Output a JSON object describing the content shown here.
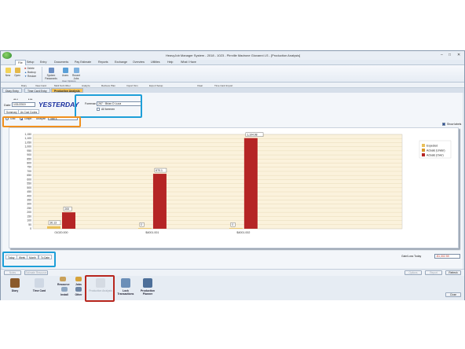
{
  "window": {
    "title": "HeavyJob Manager System - 2018 - 1023 - Plrrville Madrone Giovanni LS - [Production Analysis]",
    "controls": {
      "min": "–",
      "max": "□",
      "close": "✕"
    }
  },
  "menu": [
    "File",
    "Setup",
    "Entry",
    "Documents",
    "Pay Estimate",
    "Reports",
    "Exchange",
    "Overview",
    "Utilities",
    "Help",
    "What I Have"
  ],
  "ribbon": {
    "buttons": [
      "New",
      "Open",
      "Delete",
      "Backup",
      "Restore",
      "System Passwords",
      "Users",
      "Recent Jobs"
    ],
    "group_label": "User Options"
  },
  "toolbar": [
    "Diary",
    "View Card",
    "Multi Sub Other",
    "Analyze",
    "Retrieve Plan",
    "Import Sim",
    "Export Setup",
    "Clear",
    "Time Card Import"
  ],
  "tabs": [
    "Diary Entry",
    "Time Card Entry",
    "Production Analysis"
  ],
  "header": {
    "date_label": "Date",
    "date_value": "1/31/2019",
    "yesterday": "YESTERDAY",
    "foreman_label": "Foreman",
    "foreman_value": "267 · Brian D Luca",
    "all_foremen": "All foremen"
  },
  "subtabs": [
    "Summary",
    "As Cost Codes"
  ],
  "view": {
    "grid": "Grid",
    "graph": "Graph",
    "analyze_label": "Analyze",
    "analyze_value": "Total $"
  },
  "show_labels": "Show labels",
  "chart_data": {
    "type": "bar",
    "categories": [
      "01020.000",
      "$4001.001",
      "$4001.002"
    ],
    "series": [
      {
        "name": "Expected",
        "values": [
          30.13,
          0,
          0
        ],
        "color": "#e9c05a"
      },
      {
        "name": "Actuals (Under)",
        "values": [
          0,
          0,
          0
        ],
        "color": "#d89a2e"
      },
      {
        "name": "Actuals (Over)",
        "values": [
          200,
          670.1,
          1104.98
        ],
        "color": "#b52525"
      }
    ],
    "labels": [
      [
        "30.13",
        "0",
        "0"
      ],
      [
        "200",
        "670.1",
        "1,104.98"
      ]
    ],
    "yticks": [
      0,
      50,
      100,
      150,
      200,
      250,
      300,
      350,
      400,
      450,
      500,
      550,
      600,
      650,
      700,
      750,
      800,
      850,
      900,
      950,
      1000,
      1050,
      1100,
      1150
    ],
    "ylim": [
      0,
      1150
    ],
    "legend_position": "top-right"
  },
  "period_tabs": [
    "Today",
    "Week",
    "Month",
    "To Date"
  ],
  "gain_loss_label": "Gain/Loss Today",
  "gain_loss_value": "-$1,302.59",
  "lower_buttons": {
    "notes": "Notes",
    "estimate": "Estimate Resource",
    "options": "Options",
    "report": "Report",
    "refresh": "Refresh"
  },
  "launcher": [
    "Diary",
    "Time Card",
    "Resource",
    "Install",
    "Jobs",
    "Other",
    "Production Analysis",
    "Lock Transactions",
    "Production Planner"
  ],
  "close_label": "Close",
  "colors": {
    "highlight_blue": "#1e9fd8",
    "highlight_orange": "#f0901e",
    "highlight_red": "#b8261e"
  }
}
